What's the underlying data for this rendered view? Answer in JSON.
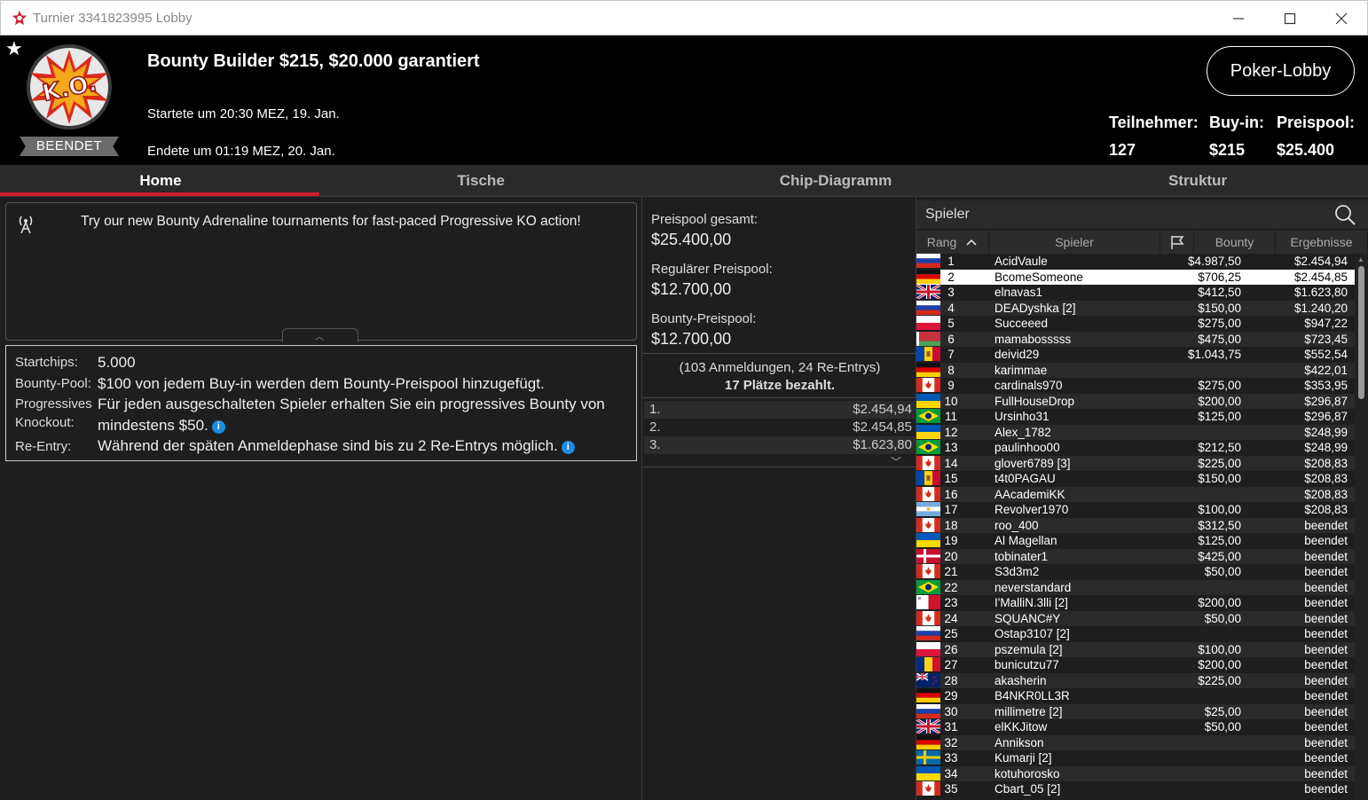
{
  "window": {
    "title": "Turnier 3341823995 Lobby"
  },
  "header": {
    "status_badge": "BEENDET",
    "tournament_name": "Bounty Builder $215, $20.000 garantiert",
    "started": "Startete um 20:30 MEZ, 19. Jan.",
    "ended": "Endete um 01:19 MEZ, 20. Jan.",
    "lobby_button": "Poker-Lobby",
    "stats": {
      "players_label": "Teilnehmer:",
      "players_value": "127",
      "buyin_label": "Buy-in:",
      "buyin_value": "$215",
      "prizepool_label": "Preispool:",
      "prizepool_value": "$25.400"
    }
  },
  "tabs": [
    "Home",
    "Tische",
    "Chip-Diagramm",
    "Struktur"
  ],
  "promo": {
    "text": "Try our new Bounty Adrenaline tournaments for fast-paced Progressive KO action!"
  },
  "info": {
    "startchips_label": "Startchips:",
    "startchips_value": "5.000",
    "bountypool_label": "Bounty-Pool:",
    "bountypool_value": "$100 von jedem Buy-in werden dem Bounty-Preispool hinzugefügt.",
    "pko_label1": "Progressives",
    "pko_label2": "Knockout:",
    "pko_value1": "Für jeden ausgeschalteten Spieler erhalten Sie ein progressives Bounty von",
    "pko_value2": "mindestens $50.",
    "reentry_label": "Re-Entry:",
    "reentry_value": "Während der späten Anmeldephase sind bis zu 2 Re-Entrys möglich."
  },
  "prizepool": {
    "total_label": "Preispool gesamt:",
    "total_value": "$25.400,00",
    "regular_label": "Regulärer Preispool:",
    "regular_value": "$12.700,00",
    "bounty_label": "Bounty-Preispool:",
    "bounty_value": "$12.700,00",
    "registrations": "(103 Anmeldungen, 24 Re-Entrys)",
    "paid": "17 Plätze bezahlt.",
    "payouts": [
      {
        "place": "1.",
        "amount": "$2.454,94"
      },
      {
        "place": "2.",
        "amount": "$2.454,85"
      },
      {
        "place": "3.",
        "amount": "$1.623,80"
      }
    ]
  },
  "players": {
    "search_label": "Spieler",
    "columns": {
      "rank": "Rang",
      "player": "Spieler",
      "bounty": "Bounty",
      "result": "Ergebnisse"
    },
    "selected_rank": 2,
    "rows": [
      {
        "rank": "1",
        "name": "AcidVaule",
        "flag": "ru",
        "bounty": "$4.987,50",
        "result": "$2.454,94"
      },
      {
        "rank": "2",
        "name": "BcomeSomeone",
        "flag": "de",
        "bounty": "$706,25",
        "result": "$2.454,85"
      },
      {
        "rank": "3",
        "name": "elnavas1",
        "flag": "gb",
        "bounty": "$412,50",
        "result": "$1.623,80"
      },
      {
        "rank": "4",
        "name": "DEADyshka [2]",
        "flag": "ru",
        "bounty": "$150,00",
        "result": "$1.240,20"
      },
      {
        "rank": "5",
        "name": "Succeeed",
        "flag": "pl",
        "bounty": "$275,00",
        "result": "$947,22"
      },
      {
        "rank": "6",
        "name": "mamabosssss",
        "flag": "by",
        "bounty": "$475,00",
        "result": "$723,45"
      },
      {
        "rank": "7",
        "name": "deivid29",
        "flag": "md",
        "bounty": "$1.043,75",
        "result": "$552,54"
      },
      {
        "rank": "8",
        "name": "karimmae",
        "flag": "de",
        "bounty": "",
        "result": "$422,01"
      },
      {
        "rank": "9",
        "name": "cardinals970",
        "flag": "ca",
        "bounty": "$275,00",
        "result": "$353,95"
      },
      {
        "rank": "10",
        "name": "FullHouseDrop",
        "flag": "ua",
        "bounty": "$200,00",
        "result": "$296,87"
      },
      {
        "rank": "11",
        "name": "Ursinho31",
        "flag": "br",
        "bounty": "$125,00",
        "result": "$296,87"
      },
      {
        "rank": "12",
        "name": "Alex_1782",
        "flag": "ua",
        "bounty": "",
        "result": "$248,99"
      },
      {
        "rank": "13",
        "name": "paulinhoo00",
        "flag": "br",
        "bounty": "$212,50",
        "result": "$248,99"
      },
      {
        "rank": "14",
        "name": "glover6789 [3]",
        "flag": "ca",
        "bounty": "$225,00",
        "result": "$208,83"
      },
      {
        "rank": "15",
        "name": "t4t0PAGAU",
        "flag": "md",
        "bounty": "$150,00",
        "result": "$208,83"
      },
      {
        "rank": "16",
        "name": "AAcademiKK",
        "flag": "ca",
        "bounty": "",
        "result": "$208,83"
      },
      {
        "rank": "17",
        "name": "Revolver1970",
        "flag": "ar",
        "bounty": "$100,00",
        "result": "$208,83"
      },
      {
        "rank": "18",
        "name": "roo_400",
        "flag": "ca",
        "bounty": "$312,50",
        "result": "beendet"
      },
      {
        "rank": "19",
        "name": "Al Magellan",
        "flag": "ua",
        "bounty": "$125,00",
        "result": "beendet"
      },
      {
        "rank": "20",
        "name": "tobinater1",
        "flag": "dk",
        "bounty": "$425,00",
        "result": "beendet"
      },
      {
        "rank": "21",
        "name": "S3d3m2",
        "flag": "ca",
        "bounty": "$50,00",
        "result": "beendet"
      },
      {
        "rank": "22",
        "name": "neverstandard",
        "flag": "br",
        "bounty": "",
        "result": "beendet"
      },
      {
        "rank": "23",
        "name": "I'MalliN.3lli [2]",
        "flag": "mt",
        "bounty": "$200,00",
        "result": "beendet"
      },
      {
        "rank": "24",
        "name": "SQUANC#Y",
        "flag": "ca",
        "bounty": "$50,00",
        "result": "beendet"
      },
      {
        "rank": "25",
        "name": "Ostap3107 [2]",
        "flag": "ru",
        "bounty": "",
        "result": "beendet"
      },
      {
        "rank": "26",
        "name": "pszemula [2]",
        "flag": "pl",
        "bounty": "$100,00",
        "result": "beendet"
      },
      {
        "rank": "27",
        "name": "bunicutzu77",
        "flag": "ro",
        "bounty": "$200,00",
        "result": "beendet"
      },
      {
        "rank": "28",
        "name": "akasherin",
        "flag": "nz",
        "bounty": "$225,00",
        "result": "beendet"
      },
      {
        "rank": "29",
        "name": "B4NKR0LL3R",
        "flag": "de",
        "bounty": "",
        "result": "beendet"
      },
      {
        "rank": "30",
        "name": "millimetre [2]",
        "flag": "ru",
        "bounty": "$25,00",
        "result": "beendet"
      },
      {
        "rank": "31",
        "name": "elKKJitow",
        "flag": "gb",
        "bounty": "$50,00",
        "result": "beendet"
      },
      {
        "rank": "32",
        "name": "Annikson",
        "flag": "de",
        "bounty": "",
        "result": "beendet"
      },
      {
        "rank": "33",
        "name": "Kumarji [2]",
        "flag": "se",
        "bounty": "",
        "result": "beendet"
      },
      {
        "rank": "34",
        "name": "kotuhorosko",
        "flag": "ua",
        "bounty": "",
        "result": "beendet"
      },
      {
        "rank": "35",
        "name": "Cbart_05 [2]",
        "flag": "ca",
        "bounty": "",
        "result": "beendet"
      }
    ]
  }
}
